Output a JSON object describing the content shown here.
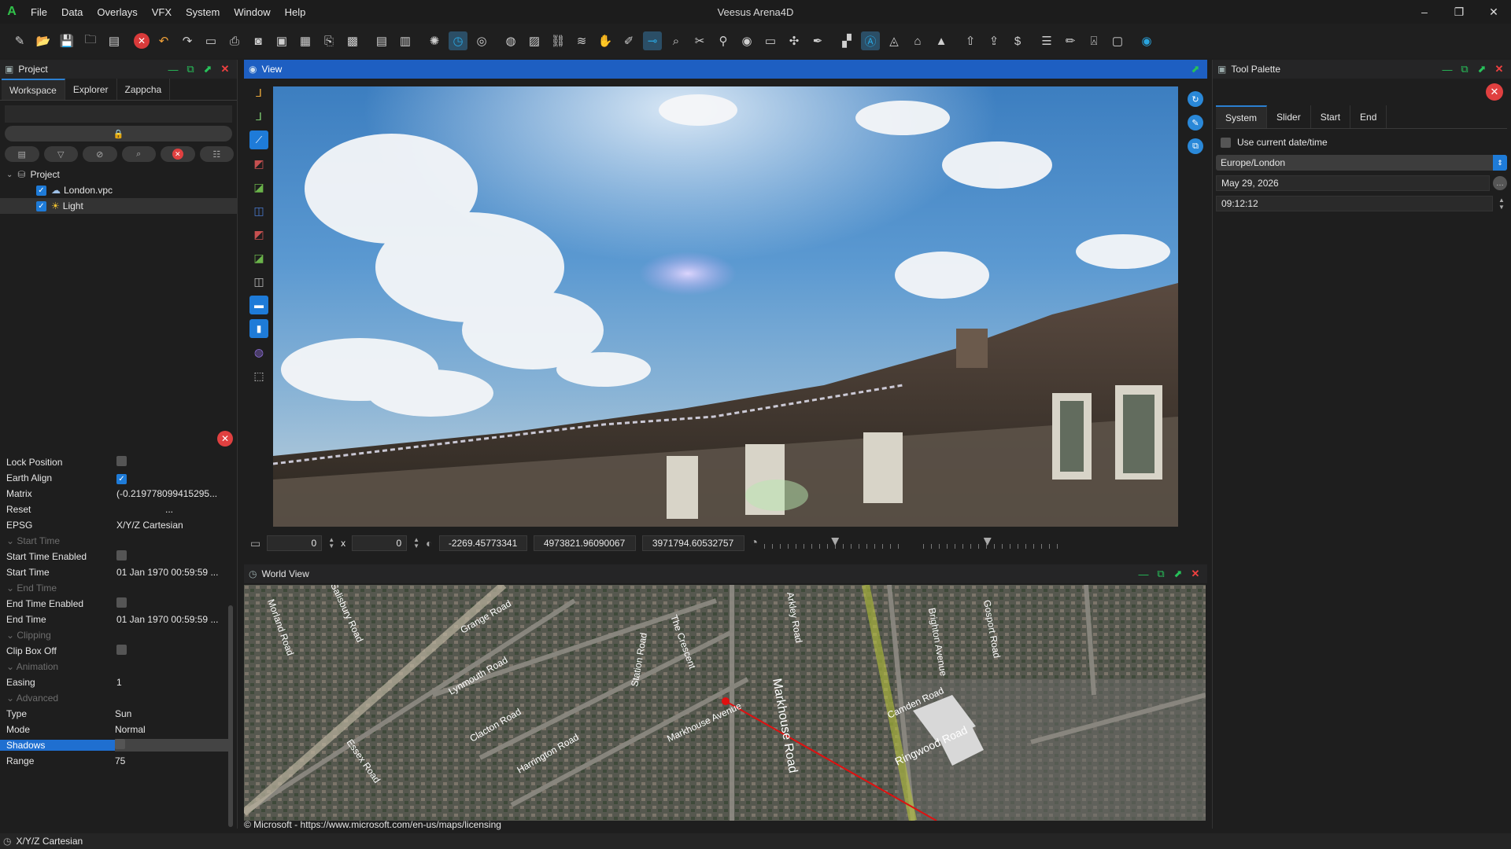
{
  "app": {
    "title": "Veesus Arena4D",
    "logo": "A"
  },
  "menu": [
    "File",
    "Data",
    "Overlays",
    "VFX",
    "System",
    "Window",
    "Help"
  ],
  "window_controls": {
    "minimize": "–",
    "restore": "❐",
    "close": "✕"
  },
  "toolbar_icons": [
    "new-icon",
    "open-icon",
    "save-icon",
    "folder-icon",
    "csv-icon",
    "stop-icon",
    "undo-icon",
    "redo-icon",
    "doc-icon",
    "print-icon",
    "camera-icon",
    "pdf-icon",
    "film-icon",
    "export-icon",
    "image-icon",
    "pdf2-icon",
    "ppt-icon",
    "globe-icon",
    "clock-icon",
    "target-icon",
    "sphere-icon",
    "picture-icon",
    "link-icon",
    "layers-icon",
    "paint-icon",
    "brush-icon",
    "tape-icon",
    "zoom-icon",
    "tools-icon",
    "pin-icon",
    "record-icon",
    "box-icon",
    "compass-icon",
    "pen-icon",
    "blocks-icon",
    "circle-a-icon",
    "nav-icon",
    "home-icon",
    "up-icon",
    "arrow-up-icon",
    "arrows-up-icon",
    "dollar-icon",
    "list-icon",
    "ruler-icon",
    "mouse-icon",
    "window-icon",
    "eye-icon"
  ],
  "project_panel": {
    "title": "Project",
    "tabs": [
      "Workspace",
      "Explorer",
      "Zappcha"
    ],
    "selected_tab": "Workspace",
    "tree": {
      "root": "Project",
      "items": [
        {
          "label": "London.vpc",
          "checked": true,
          "icon": "cloud-icon"
        },
        {
          "label": "Light",
          "checked": true,
          "icon": "sun-icon"
        }
      ]
    }
  },
  "properties": {
    "rows": [
      {
        "key": "Lock Position",
        "type": "check",
        "value": false
      },
      {
        "key": "Earth Align",
        "type": "check",
        "value": true
      },
      {
        "key": "Matrix",
        "type": "text",
        "value": "(-0.219778099415295..."
      },
      {
        "key": "Reset",
        "type": "text",
        "value": "..."
      },
      {
        "key": "EPSG",
        "type": "text",
        "value": "X/Y/Z Cartesian"
      },
      {
        "key": "Start Time",
        "type": "group"
      },
      {
        "key": "Start Time Enabled",
        "type": "check",
        "value": false
      },
      {
        "key": "Start Time",
        "type": "text",
        "value": "01 Jan 1970 00:59:59 ..."
      },
      {
        "key": "End Time",
        "type": "group"
      },
      {
        "key": "End Time Enabled",
        "type": "check",
        "value": false
      },
      {
        "key": "End Time",
        "type": "text",
        "value": "01 Jan 1970 00:59:59 ..."
      },
      {
        "key": "Clipping",
        "type": "group"
      },
      {
        "key": "Clip Box Off",
        "type": "check",
        "value": false
      },
      {
        "key": "Animation",
        "type": "group"
      },
      {
        "key": "Easing",
        "type": "text",
        "value": "1"
      },
      {
        "key": "Advanced",
        "type": "group"
      },
      {
        "key": "Type",
        "type": "text",
        "value": "Sun"
      },
      {
        "key": "Mode",
        "type": "text",
        "value": "Normal"
      },
      {
        "key": "Shadows",
        "type": "check",
        "value": false,
        "highlight": true
      },
      {
        "key": "Range",
        "type": "text",
        "value": "75"
      }
    ]
  },
  "view_panel": {
    "title": "View",
    "width_value": "0",
    "times": "x",
    "height_value": "0",
    "coord_x": "-2269.45773341",
    "coord_y": "4973821.96090067",
    "coord_z": "3971794.60532757",
    "slider1_level": 0.5,
    "slider2_level": 0.45
  },
  "world_view": {
    "title": "World View",
    "attribution": "© Microsoft - https://www.microsoft.com/en-us/maps/licensing",
    "roads": [
      "Grange Road",
      "Lynmouth Road",
      "Clacton Road",
      "Harrington Road",
      "Essex Road",
      "Markhouse Road",
      "Markhouse Avenue",
      "Brighton Avenue",
      "Gosport Road",
      "Camden Road",
      "Ringwood Road",
      "The Crescent",
      "Arkley Road",
      "Morland Road",
      "Salisbury Road",
      "Station Road"
    ]
  },
  "tool_palette": {
    "title": "Tool Palette",
    "tabs": [
      "System",
      "Slider",
      "Start",
      "End"
    ],
    "selected_tab": "System",
    "use_current_label": "Use current date/time",
    "use_current_checked": false,
    "timezone": "Europe/London",
    "date": "May 29, 2026",
    "time": "09:12:12"
  },
  "statusbar": {
    "text": "X/Y/Z Cartesian"
  }
}
